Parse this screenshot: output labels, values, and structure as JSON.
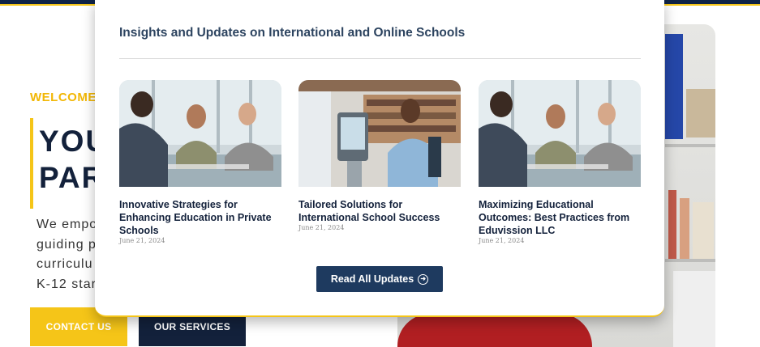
{
  "hero": {
    "welcome": "WELCOME",
    "title_line1": "YOU",
    "title_line2": "PAR",
    "text_lines": [
      "We empo",
      "guiding p",
      "curriculu",
      "K-12 start"
    ],
    "contact_label": "CONTACT US",
    "services_label": "OUR SERVICES"
  },
  "modal": {
    "title": "Insights and Updates on International and Online Schools",
    "posts": [
      {
        "title": "Innovative Strategies for Enhancing Education in Private Schools",
        "date": "June 21, 2024",
        "image": "meeting-photo"
      },
      {
        "title": "Tailored Solutions for International School Success",
        "date": "June 21, 2024",
        "image": "student-kiosk-photo"
      },
      {
        "title": "Maximizing Educational Outcomes: Best Practices from Eduvission LLC",
        "date": "June 21, 2024",
        "image": "meeting-photo"
      }
    ],
    "read_all_label": "Read All Updates",
    "read_all_icon": "arrow-circle-right-icon"
  },
  "colors": {
    "accent": "#f5c518",
    "navy": "#13213b",
    "button": "#1e3a5f"
  }
}
